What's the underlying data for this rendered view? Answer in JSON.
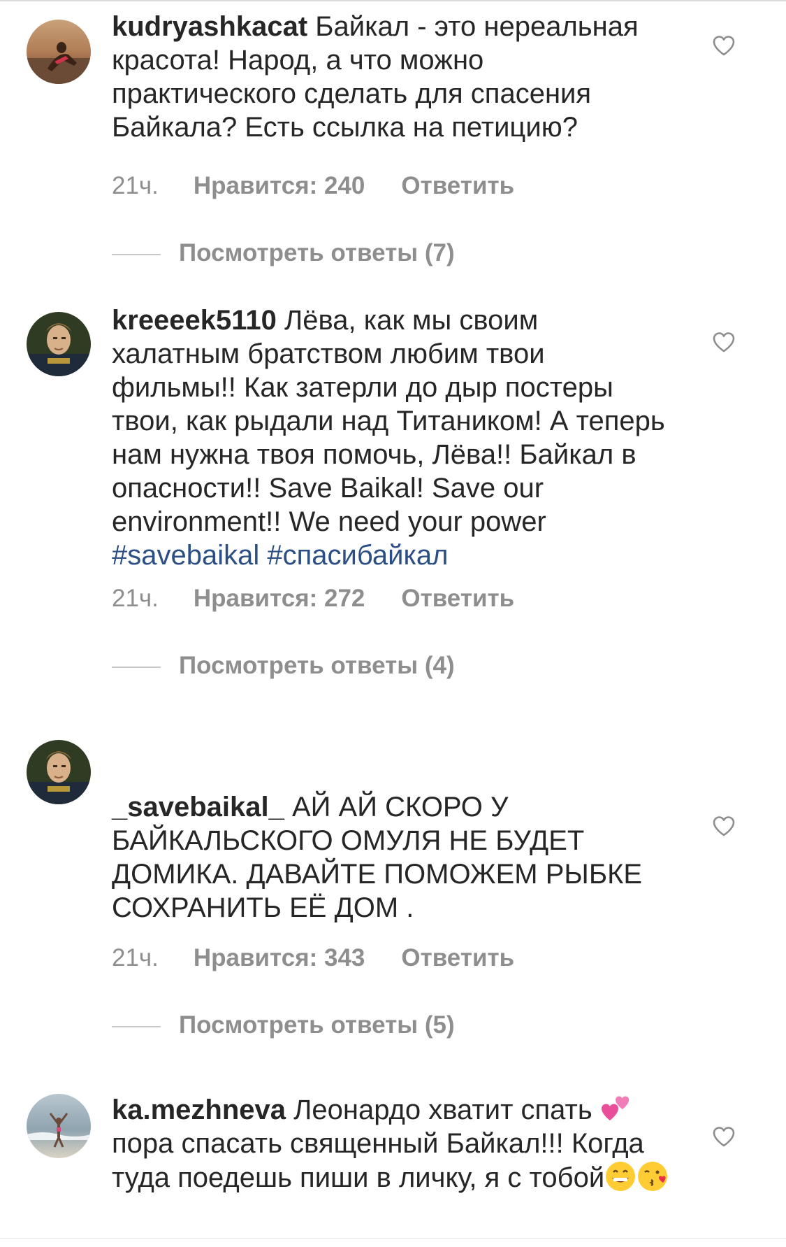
{
  "comments": [
    {
      "username": "kudryashkacat",
      "text": " Байкал - это нереальная красота! Народ, а что можно практического сделать для спасения Байкала? Есть ссылка на петицию?",
      "time": "21ч.",
      "likes": "Нравится: 240",
      "reply": "Ответить",
      "view_replies": "Посмотреть ответы (7)",
      "avatar_icon": "avatar-woman-beach"
    },
    {
      "username": "kreeeek5110",
      "text": " Лёва, как мы своим халатным братством любим твои фильмы!! Как затерли до дыр постеры твои, как рыдали над Титаником! А теперь нам нужна твоя помочь, Лёва!! Байкал в опасности!! Save Baikal! Save our environment!! We need your power ",
      "hashtags": "#savebaikal #спасибайкал",
      "time": "21ч.",
      "likes": "Нравится: 272",
      "reply": "Ответить",
      "view_replies": "Посмотреть ответы (4)",
      "avatar_icon": "avatar-portrait"
    },
    {
      "username": "_savebaikal_",
      "text": " АЙ АЙ  СКОРО У БАЙКАЛЬСКОГО ОМУЛЯ  НЕ БУДЕТ ДОМИКА. ДАВАЙТЕ ПОМОЖЕМ РЫБКЕ СОХРАНИТЬ ЕЁ ДОМ .",
      "time": "21ч.",
      "likes": "Нравится: 343",
      "reply": "Ответить",
      "view_replies": "Посмотреть ответы (5)",
      "avatar_icon": "avatar-portrait"
    },
    {
      "username": "ka.mezhneva",
      "text_part1": " Леонардо хватит спать ",
      "text_part2": "  пора спасать священный Байкал!!! Когда туда поедешь пиши в личку, я с тобой",
      "emoji_1": "two-hearts-icon",
      "emoji_2": "grinning-face-icon",
      "emoji_3": "kissing-face-icon",
      "avatar_icon": "avatar-woman-sea"
    }
  ],
  "colors": {
    "text": "#262626",
    "meta": "#8e8e8e",
    "hashtag": "#2b4f84",
    "divider": "#c7c7c7"
  }
}
